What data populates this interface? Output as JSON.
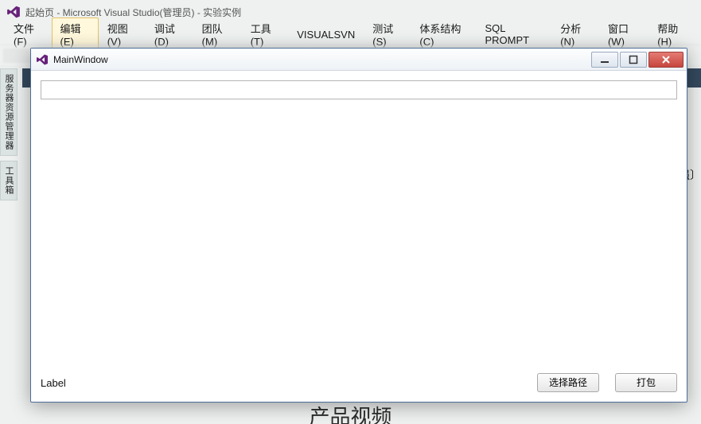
{
  "vs": {
    "title": "起始页 - Microsoft Visual Studio(管理员) - 实验实例",
    "menu": {
      "file": "文件(F)",
      "edit": "编辑(E)",
      "view": "视图(V)",
      "debug": "调试(D)",
      "team": "团队(M)",
      "tools": "工具(T)",
      "visualsvn": "VISUALSVN",
      "test": "测试(S)",
      "architecture": "体系结构(C)",
      "sqlprompt": "SQL PROMPT",
      "analyze": "分析(N)",
      "window": "窗口(W)",
      "help": "帮助(H)"
    },
    "side_tabs": {
      "server_explorer": "服务器资源管理器",
      "toolbox": "工具箱"
    },
    "background_heading": "产品视频",
    "background_right_fragment": "强〕"
  },
  "dialog": {
    "title": "MainWindow",
    "input_value": "",
    "label_text": "Label",
    "btn_select_path": "选择路径",
    "btn_pack": "打包"
  }
}
